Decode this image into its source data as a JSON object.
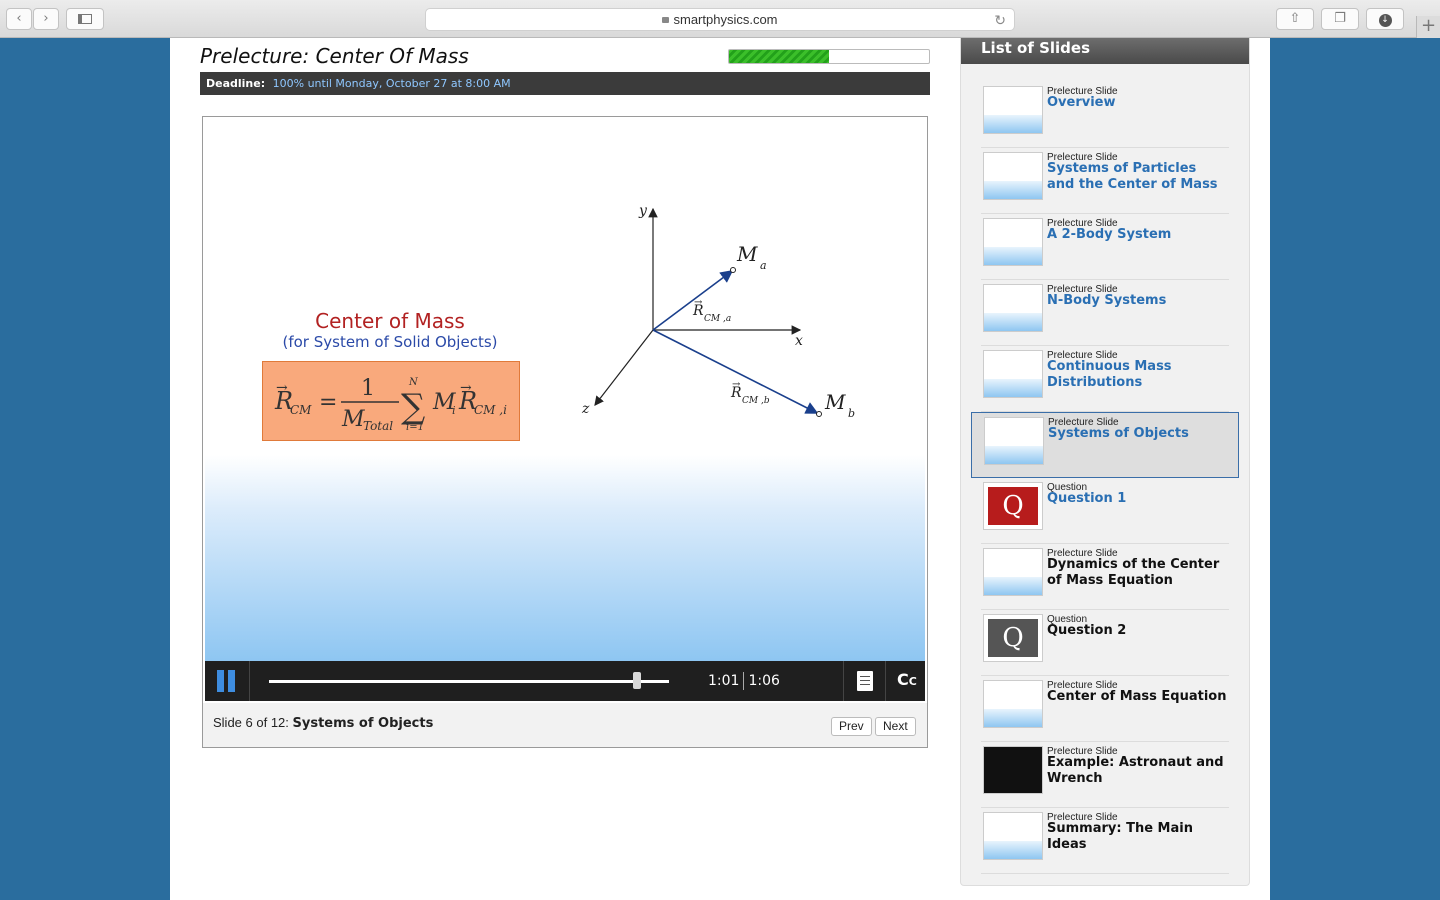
{
  "browser": {
    "url": "smartphysics.com"
  },
  "lecture": {
    "title": "Prelecture: Center Of Mass",
    "progress_fraction": 0.5,
    "deadline_label": "Deadline:",
    "deadline_value": "100% until Monday, October 27 at 8:00 AM"
  },
  "slide_content": {
    "heading": "Center of Mass",
    "subheading": "(for System of Solid Objects)"
  },
  "player": {
    "current_time": "1:01",
    "total_time": "1:06",
    "playback_fraction": 0.92,
    "cc_label": "C",
    "slide_prefix": "Slide 6 of 12:",
    "slide_name": "Systems of Objects",
    "prev_label": "Prev",
    "next_label": "Next"
  },
  "sidebar": {
    "title": "List of Slides",
    "items": [
      {
        "type": "Prelecture Slide",
        "name": "Overview",
        "status": "viewed"
      },
      {
        "type": "Prelecture Slide",
        "name": "Systems of Particles and the Center of Mass",
        "status": "viewed"
      },
      {
        "type": "Prelecture Slide",
        "name": "A 2-Body System",
        "status": "viewed"
      },
      {
        "type": "Prelecture Slide",
        "name": "N-Body Systems",
        "status": "viewed"
      },
      {
        "type": "Prelecture Slide",
        "name": "Continuous Mass Distributions",
        "status": "viewed"
      },
      {
        "type": "Prelecture Slide",
        "name": "Systems of Objects",
        "status": "current"
      },
      {
        "type": "Question",
        "name": "Question 1",
        "status": "viewed"
      },
      {
        "type": "Prelecture Slide",
        "name": "Dynamics of the Center of Mass Equation",
        "status": "unviewed"
      },
      {
        "type": "Question",
        "name": "Question 2",
        "status": "unviewed"
      },
      {
        "type": "Prelecture Slide",
        "name": "Center of Mass Equation",
        "status": "unviewed"
      },
      {
        "type": "Prelecture Slide",
        "name": "Example: Astronaut and Wrench",
        "status": "unviewed"
      },
      {
        "type": "Prelecture Slide",
        "name": "Summary: The Main Ideas",
        "status": "unviewed"
      }
    ]
  },
  "colors": {
    "link_blue": "#2a6fb3",
    "progress_green": "#2bb021",
    "deadline_bar": "#3b3b3b",
    "question_red": "#b71c1c"
  }
}
